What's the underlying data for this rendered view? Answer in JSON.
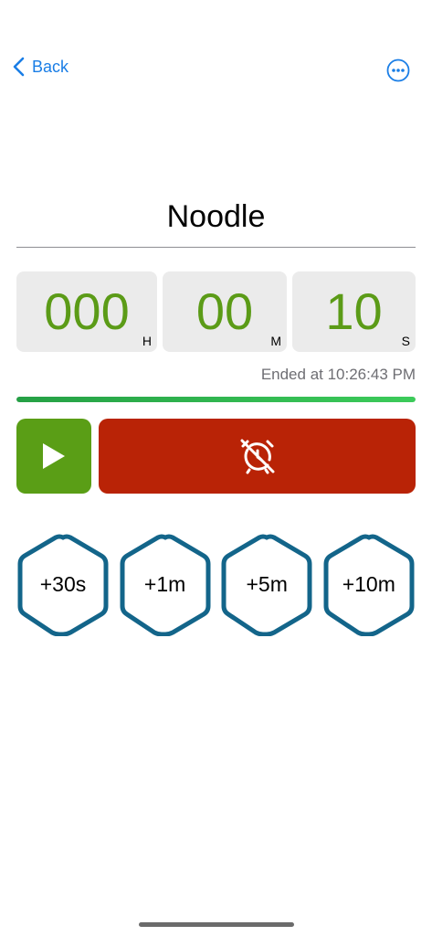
{
  "nav": {
    "back_label": "Back",
    "back_icon": "chevron-left-icon",
    "more_icon": "ellipsis-circle-icon"
  },
  "timer": {
    "name": "Noodle",
    "hours": "000",
    "hours_unit": "H",
    "minutes": "00",
    "minutes_unit": "M",
    "seconds": "10",
    "seconds_unit": "S",
    "ended_text": "Ended at 10:26:43 PM",
    "progress_fraction": 1.0
  },
  "controls": {
    "play_icon": "play-icon",
    "stop_icon": "alarm-off-icon"
  },
  "quick_add": [
    {
      "label": "+30s"
    },
    {
      "label": "+1m"
    },
    {
      "label": "+5m"
    },
    {
      "label": "+10m"
    }
  ],
  "colors": {
    "accent_blue": "#1a7ee6",
    "digit_green": "#5b9b17",
    "play_green": "#5a9e16",
    "stop_red": "#b92306",
    "hex_border": "#13658a"
  }
}
